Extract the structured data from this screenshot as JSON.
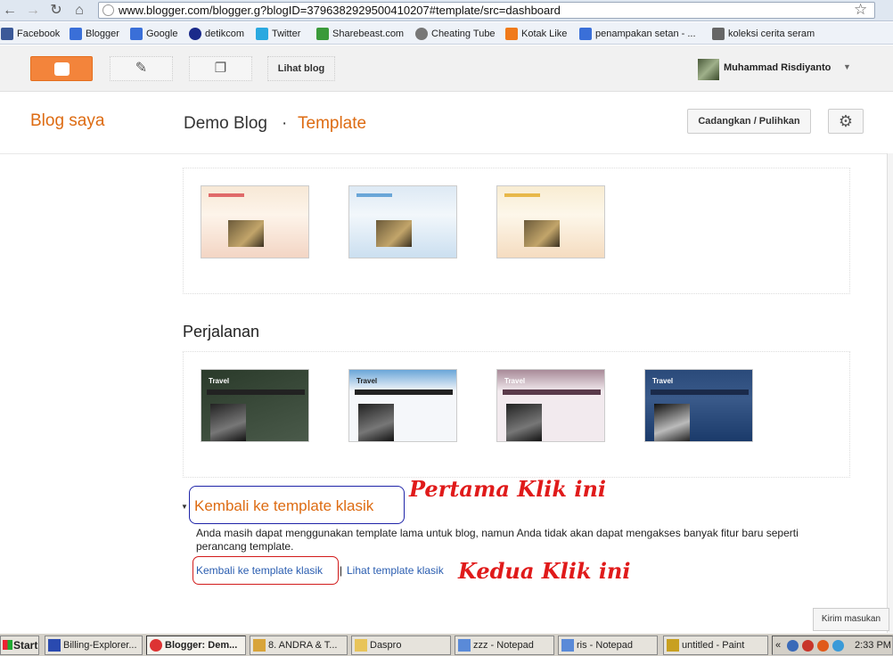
{
  "browser": {
    "url": "www.blogger.com/blogger.g?blogID=3796382929500410207#template/src=dashboard",
    "bookmarks": [
      {
        "label": "Facebook",
        "color": "#3b5998"
      },
      {
        "label": "Blogger",
        "color": "#3a6fd8"
      },
      {
        "label": "Google",
        "color": "#3a6fd8"
      },
      {
        "label": "detikcom",
        "color": "#1a2a8a"
      },
      {
        "label": "Twitter",
        "color": "#2aa9e0"
      },
      {
        "label": "Sharebeast.com",
        "color": "#3a9a3a"
      },
      {
        "label": "Cheating Tube",
        "color": "#777777"
      },
      {
        "label": "Kotak Like",
        "color": "#f07a1a"
      },
      {
        "label": "penampakan setan - ...",
        "color": "#3a6fd8"
      },
      {
        "label": "koleksi cerita seram",
        "color": "#666666"
      }
    ]
  },
  "header": {
    "view_blog_label": "Lihat blog",
    "user_name": "Muhammad Risdiyanto"
  },
  "subheader": {
    "my_blogs": "Blog saya",
    "blog_name": "Demo Blog",
    "separator": "·",
    "section": "Template",
    "backup_label": "Cadangkan / Pulihkan"
  },
  "templates": {
    "travel_heading": "Perjalanan",
    "travel_thumb_title": "Travel"
  },
  "classic": {
    "heading": "Kembali ke template klasik",
    "description": "Anda masih dapat menggunakan template lama untuk blog, namun Anda tidak akan dapat mengakses banyak fitur baru seperti perancang template.",
    "revert_link": "Kembali ke template klasik",
    "pipe": "|",
    "view_link": "Lihat template klasik"
  },
  "annotations": {
    "first": "Pertama Klik ini",
    "second": "Kedua Klik ini"
  },
  "feedback_label": "Kirim masukan",
  "taskbar": {
    "start_label": "Start",
    "tasks": [
      "Billing-Explorer...",
      "Blogger: Dem...",
      "8. ANDRA & T...",
      "Daspro",
      "zzz - Notepad",
      "ris - Notepad",
      "untitled - Paint"
    ],
    "tray_arrows": "«",
    "clock": "2:33 PM"
  },
  "colors": {
    "accent": "#dd6b12",
    "annotation_red": "#e01a1a",
    "box_blue": "#1f24a8",
    "link_blue": "#2a5db0"
  }
}
